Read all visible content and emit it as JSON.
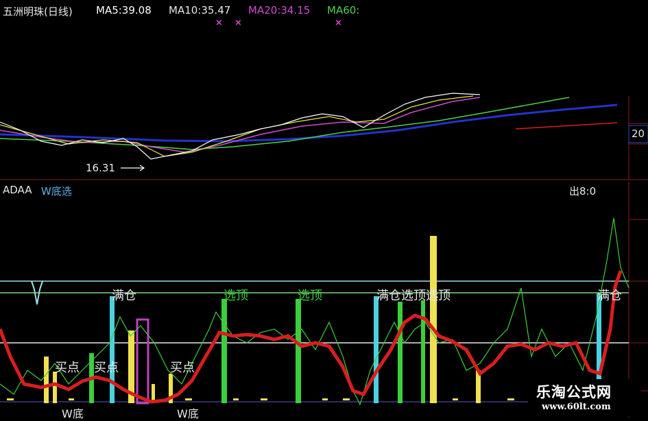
{
  "upper_panel": {
    "stock_name": "五洲明珠(日线)",
    "ma5": "MA5:39.08",
    "ma10": "MA10:35.47",
    "ma20": "MA20:34.15",
    "ma60": "MA60:",
    "low_price_label": "16.31",
    "axis_fragment": "20",
    "colors": {
      "ma5": "#ffffff",
      "ma10": "#e8e84a",
      "ma20": "#d24cd2",
      "ma60": "#4cd24c",
      "ma120": "#2233cc"
    }
  },
  "lower_panel": {
    "indicator_name": "ADAA",
    "indicator_sub": "W底选",
    "corner_text": "出8:0",
    "labels": {
      "full1": "满仓",
      "select_top1": "选顶",
      "select_top2": "选顶",
      "full_select_top": "满仓选顶选顶",
      "full2": "满仓",
      "buy1": "买点",
      "buy2": "买点",
      "buy3": "买点",
      "bottom1": "W底",
      "bottom2": "W底"
    },
    "colors": {
      "red_line": "#d81e1e",
      "green_line": "#3ccf3c",
      "cyan_bar": "#4cd0e0",
      "yellow_bar": "#f0e050",
      "magenta": "#c040c0",
      "white_line": "#e8e8e8",
      "ref_top": "#9ee0ee",
      "ref_mid": "#7cd87c"
    }
  },
  "watermark": {
    "title": "乐淘公式网",
    "url": "www.60lt.com"
  }
}
